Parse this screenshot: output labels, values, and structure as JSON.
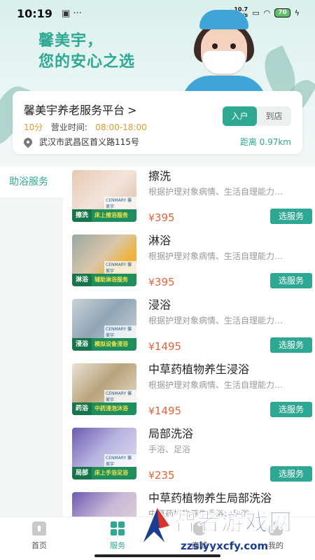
{
  "status_bar": {
    "time": "10:19",
    "icons": "▣ ···",
    "speed": "10.7\nKB/s",
    "battery": "70"
  },
  "hero": {
    "slogan_line1": "馨美宇，",
    "slogan_line2": "您的安心之选"
  },
  "store": {
    "name": "馨美宇养老服务平台",
    "chevron": ">",
    "tabs": [
      {
        "label": "入户",
        "active": true
      },
      {
        "label": "到店",
        "active": false
      }
    ],
    "eta": "10分",
    "hours_label": "营业时间:",
    "hours_value": "08:00-18:00",
    "address": "武汉市武昌区首义路115号",
    "distance": "距离 0.97km"
  },
  "sidebar": {
    "items": [
      {
        "label": "助浴服务",
        "active": true
      }
    ]
  },
  "services": [
    {
      "title": "擦洗",
      "desc": "根据护理对象病情、生活自理能力…",
      "price": "395",
      "button": "选服务",
      "tag": "擦洗",
      "tag_text": "床上擦浴服务"
    },
    {
      "title": "淋浴",
      "desc": "根据护理对象病情、生活自理能力…",
      "price": "395",
      "button": "选服务",
      "tag": "淋浴",
      "tag_text": "辅助淋浴服务"
    },
    {
      "title": "浸浴",
      "desc": "根据护理对象病情、生活自理能力…",
      "price": "1495",
      "button": "选服务",
      "tag": "浸浴",
      "tag_text": "模拟设备浸浴"
    },
    {
      "title": "中草药植物养生浸浴",
      "desc": "根据护理对象病情、生活自理能力…",
      "price": "1495",
      "button": "选服务",
      "tag": "药浴",
      "tag_text": "中药浸泡沐浴"
    },
    {
      "title": "局部洗浴",
      "desc": "手浴、足浴",
      "price": "235",
      "button": "选服务",
      "tag": "局部",
      "tag_text": "床上手浴足浴"
    },
    {
      "title": "中草药植物养生局部洗浴",
      "desc": "中草药植物养生手浴、足浴",
      "price": "",
      "button": "",
      "tag": "",
      "tag_text": ""
    }
  ],
  "price_symbol": "¥",
  "brand_small": "CENMARY 馨美宇",
  "nav": {
    "items": [
      {
        "label": "首页",
        "active": false
      },
      {
        "label": "服务",
        "active": true
      },
      {
        "label": "商城",
        "active": false
      },
      {
        "label": "我的",
        "active": false
      }
    ]
  },
  "watermark": {
    "text": "智者游戏网",
    "url": "zzslyyxcfy.com"
  },
  "colors": {
    "accent": "#2ea893",
    "price": "#e3643a",
    "hours": "#e59a2c"
  }
}
